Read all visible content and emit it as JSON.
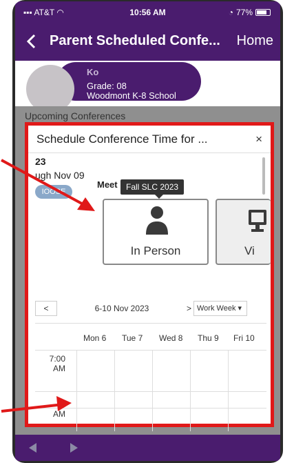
{
  "status_bar": {
    "carrier": "AT&T",
    "time": "10:56 AM",
    "battery": "77%",
    "battery_level": 0.77
  },
  "nav": {
    "title": "Parent Scheduled Confe...",
    "home_label": "Home"
  },
  "student": {
    "name": "Ko",
    "grade": "Grade: 08",
    "school": "Woodmont K-8 School"
  },
  "upcoming_label": "Upcoming Conferences",
  "modal": {
    "title": "Schedule Conference Time for ...",
    "close": "×",
    "year": "23",
    "range": "ugh Nov 09",
    "choose": "IOOSE",
    "meet_label": "Meet",
    "tooltip": "Fall SLC 2023",
    "options": [
      {
        "label": "In Person",
        "icon": "person-icon"
      },
      {
        "label": "Vi",
        "icon": "monitor-icon"
      }
    ]
  },
  "calendar": {
    "prev": "<",
    "range": "6-10 Nov 2023",
    "next": ">",
    "view": "Work Week ▾",
    "days": [
      "Mon 6",
      "Tue 7",
      "Wed 8",
      "Thu 9",
      "Fri 10"
    ],
    "times": [
      "7:00\nAM",
      "7:\nAM"
    ]
  },
  "colors": {
    "brand": "#4a1c6e",
    "highlight": "#e01919"
  }
}
